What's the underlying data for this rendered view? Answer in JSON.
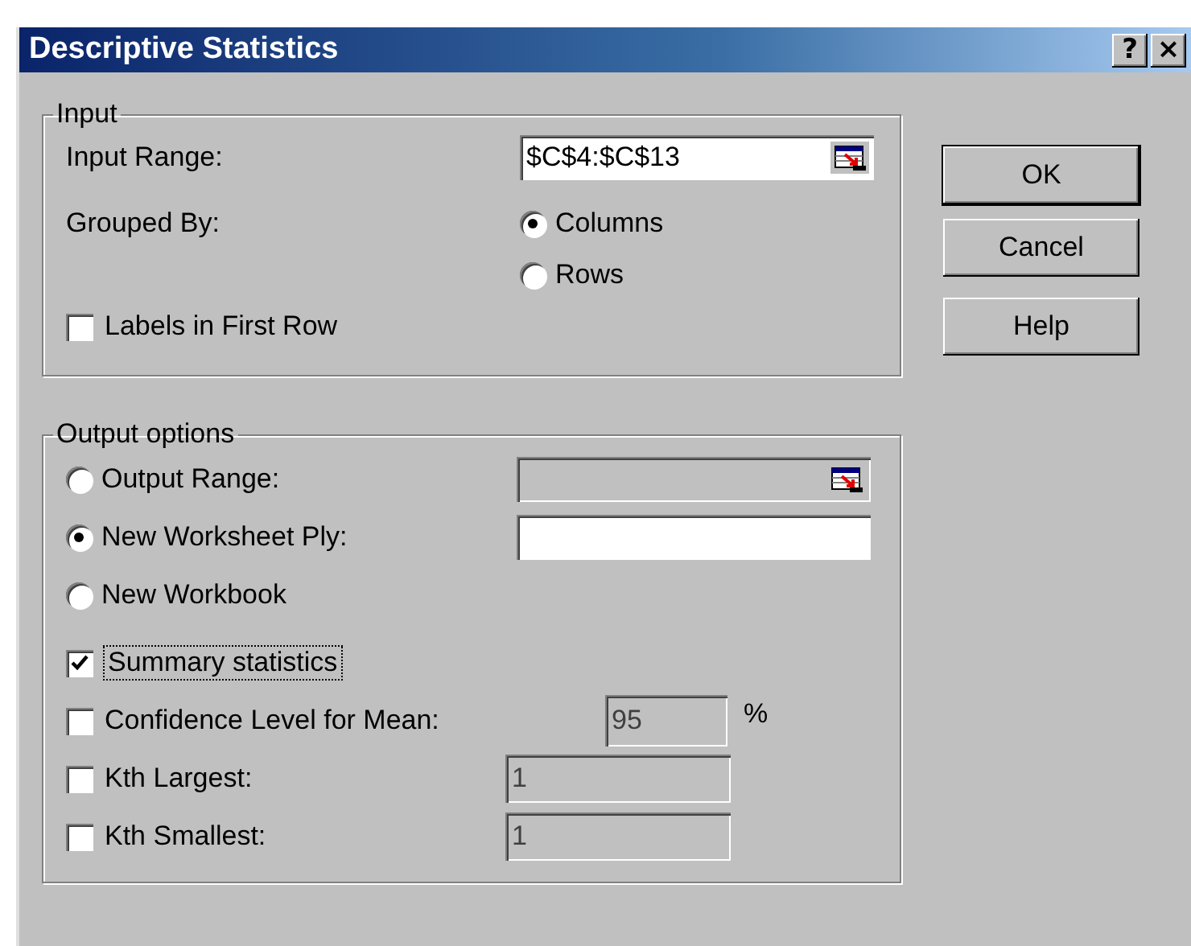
{
  "window": {
    "title": "Descriptive Statistics",
    "title_buttons": [
      "?",
      "×"
    ]
  },
  "input": {
    "title": "Input",
    "range": {
      "label": "Input Range:",
      "value": "$C$4:$C$13",
      "disabled": false
    },
    "grouped_by": {
      "label": "Grouped By:",
      "options": [
        {
          "label": "Columns",
          "selected": true
        },
        {
          "label": "Rows",
          "selected": false
        }
      ]
    },
    "labels_in_first_row": {
      "label": "Labels in First Row",
      "checked": false
    }
  },
  "output": {
    "title": "Output options",
    "items": [
      {
        "kind": "radio",
        "label": "Output Range:",
        "selected": false,
        "field": {
          "kind": "reference",
          "disabled": true
        }
      },
      {
        "kind": "radio",
        "label": "New Worksheet Ply:",
        "selected": true,
        "field": {
          "kind": "text",
          "disabled": false
        }
      },
      {
        "kind": "radio",
        "label": "New Workbook",
        "selected": false
      },
      {
        "kind": "checkbox",
        "label": "Summary statistics",
        "checked": true,
        "focused": true
      },
      {
        "kind": "checkbox",
        "label": "Confidence Level for Mean:",
        "checked": false,
        "focused": false,
        "field": {
          "kind": "percent",
          "disabled": true,
          "value": "95",
          "suffix": "%"
        }
      },
      {
        "kind": "checkbox",
        "label": "Kth Largest:",
        "checked": false,
        "focused": false,
        "field": {
          "kind": "number",
          "disabled": true,
          "value": "1"
        }
      },
      {
        "kind": "checkbox",
        "label": "Kth Smallest:",
        "checked": false,
        "focused": false,
        "field": {
          "kind": "number",
          "disabled": true,
          "value": "1"
        }
      }
    ]
  },
  "buttons": [
    {
      "label": "OK"
    },
    {
      "label": "Cancel"
    },
    {
      "label": "Help"
    }
  ]
}
